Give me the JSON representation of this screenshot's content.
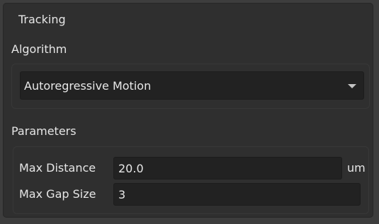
{
  "panel": {
    "title": "Tracking"
  },
  "algorithm": {
    "label": "Algorithm",
    "selected": "Autoregressive Motion"
  },
  "parameters": {
    "label": "Parameters",
    "max_distance": {
      "label": "Max Distance",
      "value": "20.0",
      "unit": "um"
    },
    "max_gap_size": {
      "label": "Max Gap Size",
      "value": "3"
    }
  },
  "icons": {
    "dropdown": "chevron-down-icon"
  },
  "colors": {
    "background": "#3d3d3d",
    "panel": "#2f2f2f",
    "field": "#222222",
    "text": "#e6e6e6"
  }
}
